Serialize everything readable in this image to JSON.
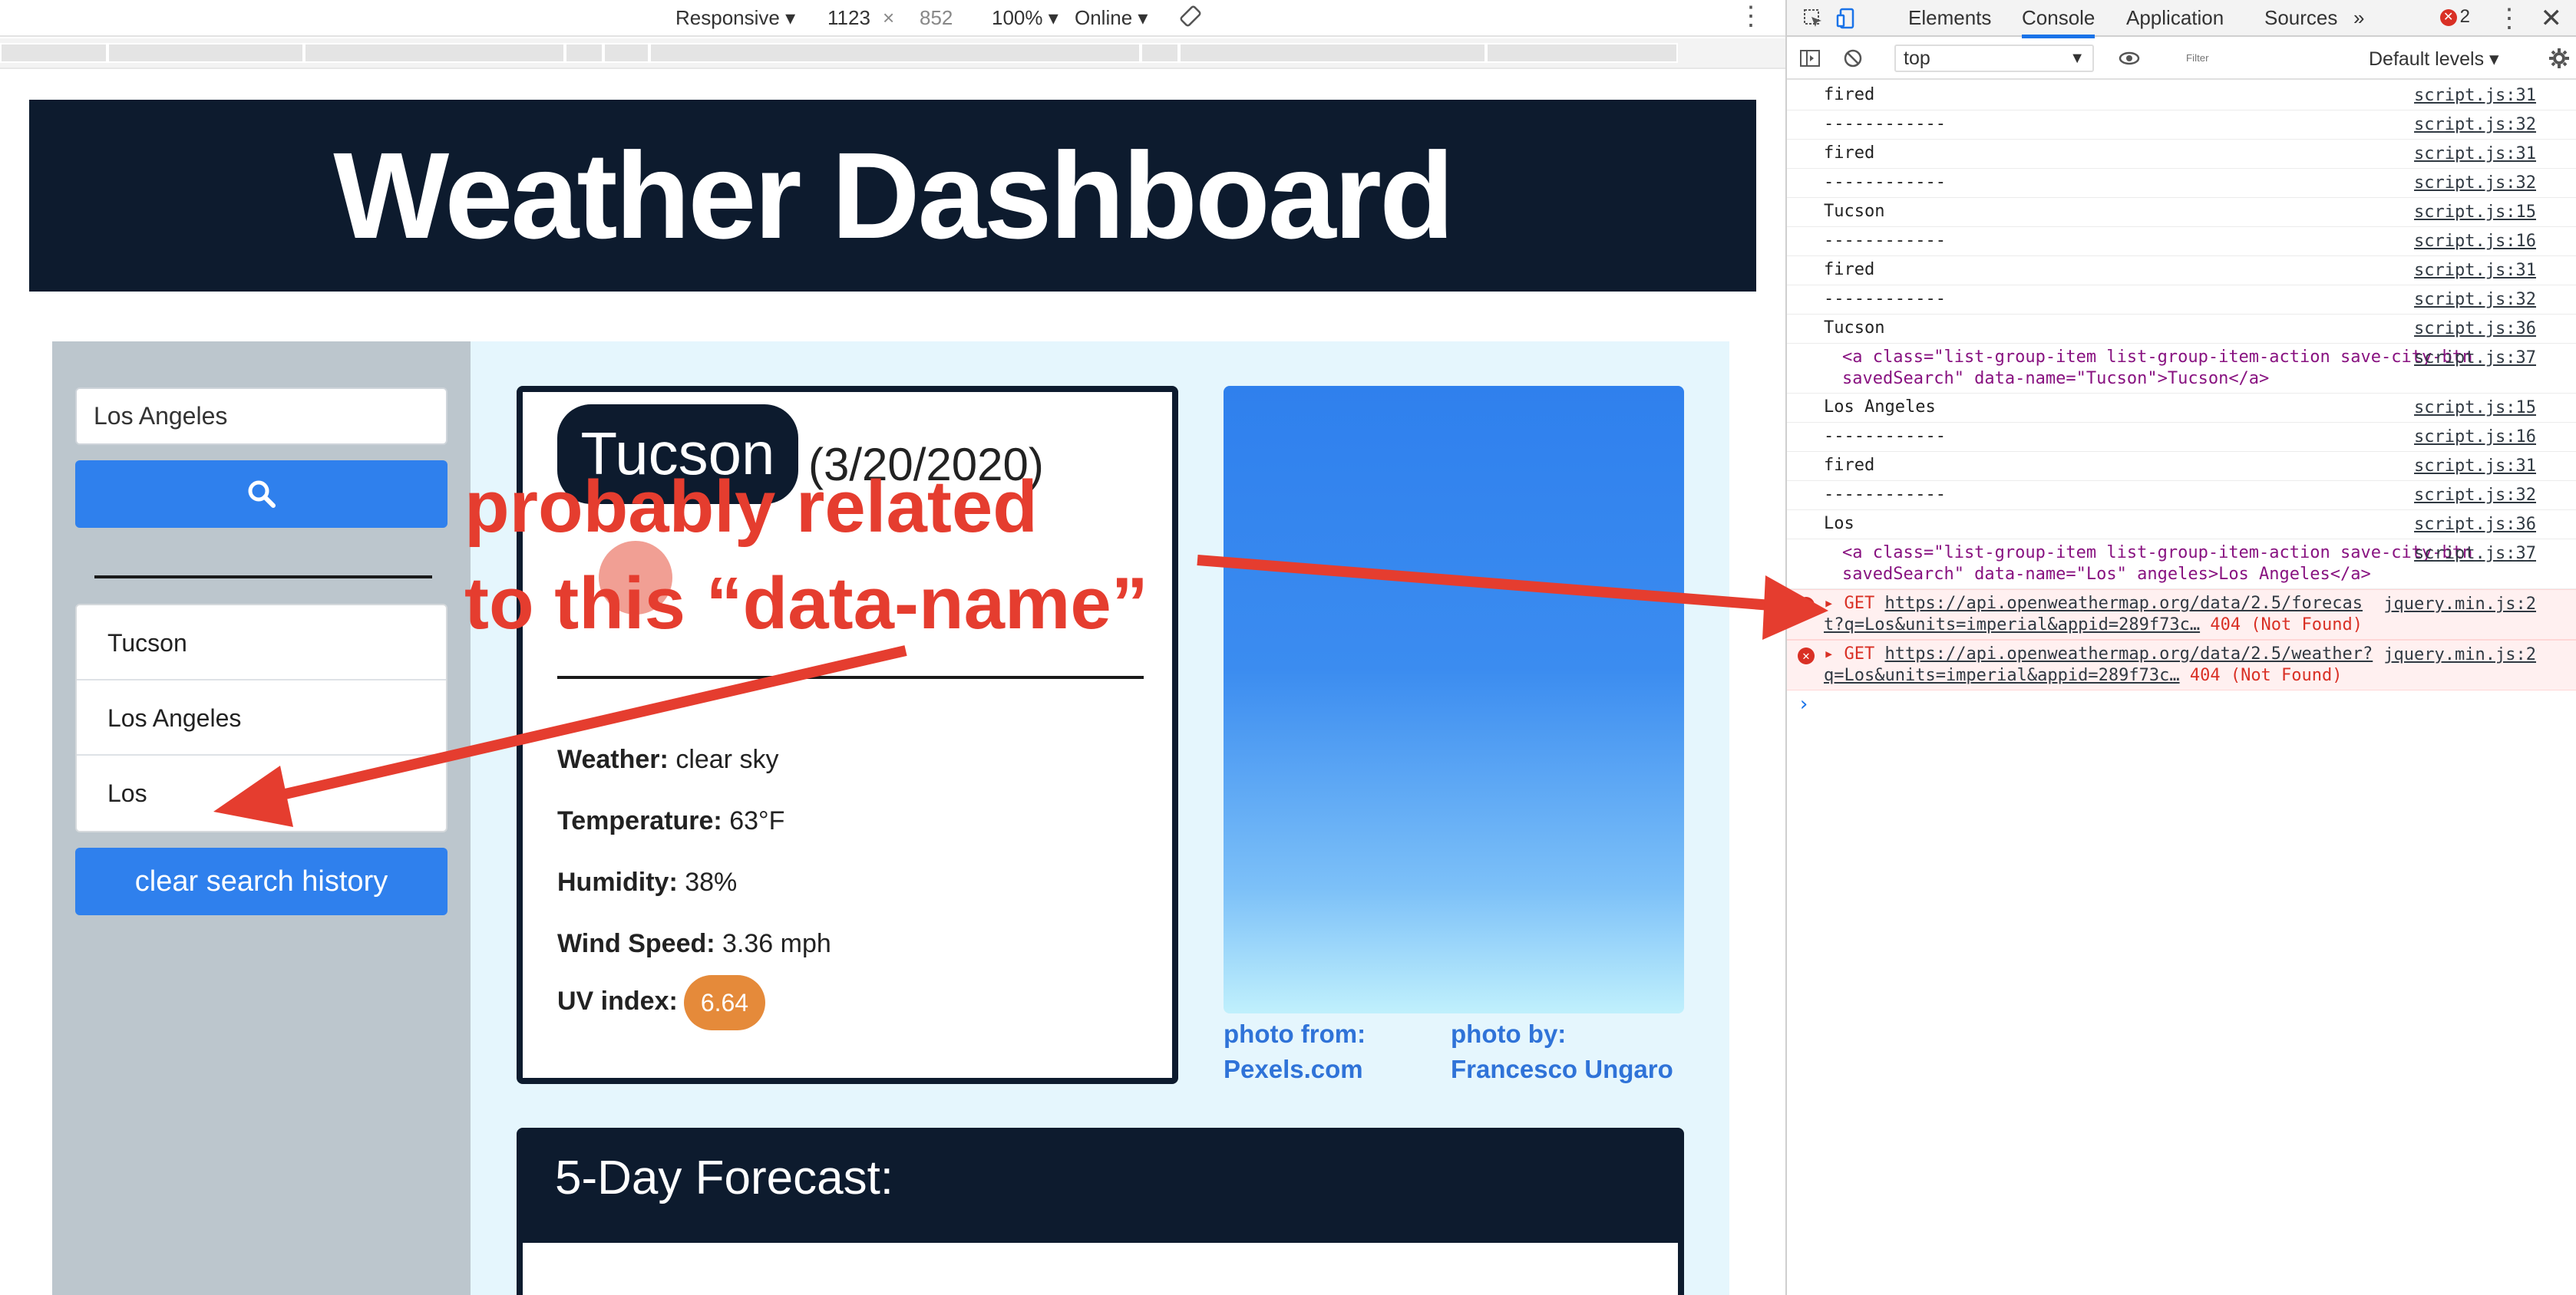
{
  "devtools_toolbar": {
    "device": "Responsive",
    "width": "1123",
    "times": "×",
    "height": "852",
    "zoom": "100%",
    "network": "Online"
  },
  "page": {
    "title": "Weather Dashboard",
    "search": {
      "value": "Los Angeles"
    },
    "saved_searches": [
      "Tucson",
      "Los Angeles",
      "Los"
    ],
    "clear_button": "clear search history",
    "current": {
      "city": "Tucson",
      "date": "(3/20/2020)",
      "weather_label": "Weather:",
      "weather_value": "clear sky",
      "temp_label": "Temperature:",
      "temp_value": "63°F",
      "humidity_label": "Humidity:",
      "humidity_value": "38%",
      "wind_label": "Wind Speed:",
      "wind_value": "3.36 mph",
      "uv_label": "UV index:",
      "uv_value": "6.64"
    },
    "credit_from_label": "photo from:",
    "credit_from_value": "Pexels.com",
    "credit_by_label": "photo by:",
    "credit_by_value": "Francesco Ungaro",
    "forecast_title": "5-Day Forecast:"
  },
  "annotation": {
    "line1": "probably related",
    "line2": "to this “data-name”"
  },
  "devtools": {
    "tabs": [
      "Elements",
      "Console",
      "Application",
      "Sources",
      "»"
    ],
    "error_count": "2",
    "context": "top",
    "filter_placeholder": "Filter",
    "levels": "Default levels ▾",
    "logs": [
      {
        "text": "fired",
        "src": "script.js:31"
      },
      {
        "text": "------------",
        "src": "script.js:32"
      },
      {
        "text": "fired",
        "src": "script.js:31"
      },
      {
        "text": "------------",
        "src": "script.js:32"
      },
      {
        "text": "Tucson",
        "src": "script.js:15"
      },
      {
        "text": "------------",
        "src": "script.js:16"
      },
      {
        "text": "fired",
        "src": "script.js:31"
      },
      {
        "text": "------------",
        "src": "script.js:32"
      },
      {
        "text": "Tucson",
        "src": "script.js:36"
      }
    ],
    "html1": {
      "src": "script.js:37",
      "line_a": "<a class=\"list-group-item list-group-item-action save-city-btn",
      "line_b": "savedSearch\" data-name=\"Tucson\">Tucson</a>"
    },
    "logs2": [
      {
        "text": "Los Angeles",
        "src": "script.js:15"
      },
      {
        "text": "------------",
        "src": "script.js:16"
      },
      {
        "text": "fired",
        "src": "script.js:31"
      },
      {
        "text": "------------",
        "src": "script.js:32"
      },
      {
        "text": "Los",
        "src": "script.js:36"
      }
    ],
    "html2": {
      "src": "script.js:37",
      "line_a": "<a class=\"list-group-item list-group-item-action save-city-btn",
      "line_b": "savedSearch\" data-name=\"Los\" angeles>Los Angeles</a>"
    },
    "errors": [
      {
        "method": "▸ GET",
        "url1": "https://api.openweathermap.org/data/2.5/forecas",
        "url2": "t?q=Los&units=imperial&appid=289f73c…",
        "status": "404 (Not Found)",
        "src": "jquery.min.js:2"
      },
      {
        "method": "▸ GET",
        "url1": "https://api.openweathermap.org/data/2.5/weather?",
        "url2": "q=Los&units=imperial&appid=289f73c…",
        "status": "404 (Not Found)",
        "src": "jquery.min.js:2"
      }
    ],
    "prompt": "›"
  },
  "colors": {
    "navy": "#0d1b2e",
    "accent": "#2f80ed",
    "annotation": "#e53d2f",
    "uv": "#e58a3a"
  }
}
